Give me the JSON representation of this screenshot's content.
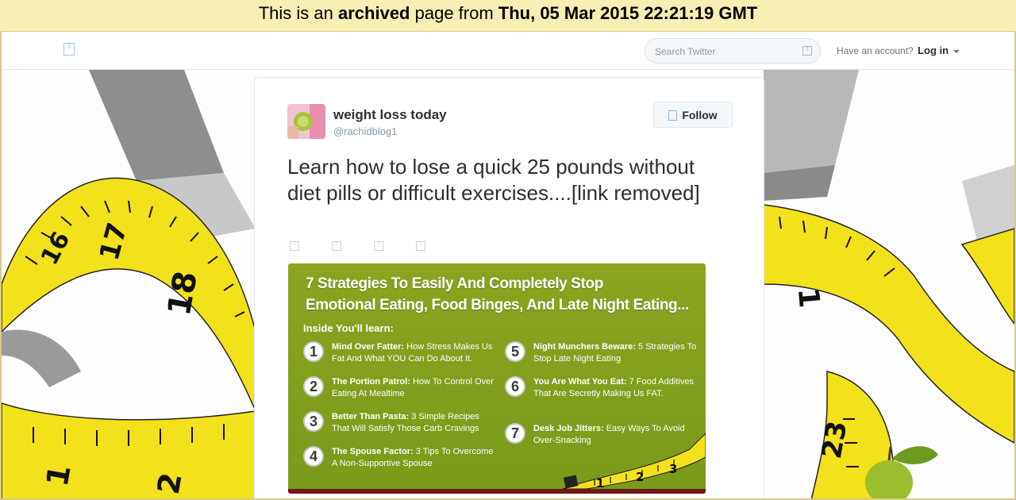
{
  "archive": {
    "prefix": "This is an ",
    "archived": "archived",
    "middle": " page from ",
    "date": "Thu, 05 Mar 2015 22:21:19 GMT"
  },
  "topbar": {
    "search_placeholder": "Search Twitter",
    "have_account": "Have an account?",
    "login": "Log in"
  },
  "tweet": {
    "name": "weight loss today",
    "handle": "@rachidblog1",
    "follow": "Follow",
    "text": "Learn how to lose a quick 25 pounds without diet pills or difficult exercises....[link removed]"
  },
  "promo": {
    "title_line1": "7 Strategies To Easily And Completely Stop",
    "title_line2": "Emotional Eating, Food Binges, And Late Night Eating...",
    "inside": "Inside You'll learn:",
    "strategies": [
      {
        "num": "1",
        "bold": "Mind Over Fatter:",
        "rest": " How Stress Makes Us Fat And What YOU Can Do About It."
      },
      {
        "num": "2",
        "bold": "The Portion Patrol:",
        "rest": " How To Control Over Eating At Mealtime"
      },
      {
        "num": "3",
        "bold": "Better Than Pasta:",
        "rest": " 3 Simple Recipes That Will Satisfy Those Carb Cravings"
      },
      {
        "num": "4",
        "bold": "The Spouse Factor:",
        "rest": " 3 Tips To Overcome A Non-Supportive Spouse"
      },
      {
        "num": "5",
        "bold": "Night Munchers Beware:",
        "rest": " 5 Strategies To Stop Late Night Eating"
      },
      {
        "num": "6",
        "bold": "You Are What You Eat:",
        "rest": " 7 Food Additives That Are Secretly Making Us FAT."
      },
      {
        "num": "7",
        "bold": "Desk Job Jitters:",
        "rest": " Easy Ways To Avoid Over-Snacking"
      }
    ],
    "tape_numbers": [
      "1",
      "2",
      "3"
    ]
  },
  "background_tape": {
    "left_numbers": [
      "16",
      "17",
      "18",
      "1",
      "2"
    ],
    "right_numbers": [
      "1",
      "23"
    ]
  },
  "colors": {
    "banner": "#f6eeb3",
    "tape_yellow": "#f3e11c",
    "promo_green": "#86a31e"
  }
}
